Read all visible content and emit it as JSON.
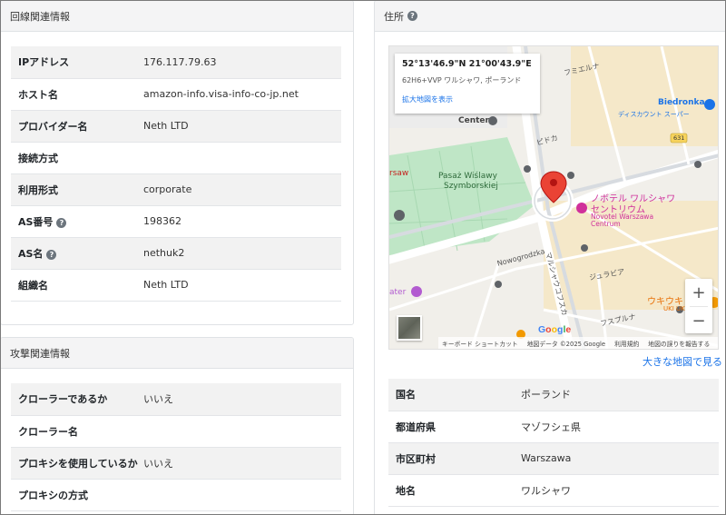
{
  "line_info": {
    "title": "回線関連情報",
    "rows": [
      {
        "key": "IPアドレス",
        "value": "176.117.79.63"
      },
      {
        "key": "ホスト名",
        "value": "amazon-info.visa-info-co-jp.net"
      },
      {
        "key": "プロバイダー名",
        "value": "Neth LTD"
      },
      {
        "key": "接続方式",
        "value": ""
      },
      {
        "key": "利用形式",
        "value": "corporate"
      },
      {
        "key": "AS番号",
        "value": "198362"
      },
      {
        "key": "AS名",
        "value": "nethuk2"
      },
      {
        "key": "組織名",
        "value": "Neth LTD"
      }
    ]
  },
  "attack_info": {
    "title": "攻撃関連情報",
    "rows": [
      {
        "key": "クローラーであるか",
        "value": "いいえ"
      },
      {
        "key": "クローラー名",
        "value": ""
      },
      {
        "key": "プロキシを使用しているか",
        "value": "いいえ"
      },
      {
        "key": "プロキシの方式",
        "value": ""
      }
    ]
  },
  "address": {
    "title": "住所",
    "larger_map_link": "大きな地図で見る",
    "rows": [
      {
        "key": "国名",
        "value": "ポーランド"
      },
      {
        "key": "都道府県",
        "value": "マゾフシェ県"
      },
      {
        "key": "市区町村",
        "value": "Warszawa"
      },
      {
        "key": "地名",
        "value": "ワルシャワ"
      }
    ]
  },
  "map": {
    "info_coords": "52°13'46.9\"N 21°00'43.9\"E",
    "info_plus_code": "62H6+VVP ワルシャワ, ポーランド",
    "info_link": "拡大地図を表示",
    "zoom_in": "+",
    "zoom_out": "−",
    "google_logo": "Google",
    "attribution": {
      "shortcuts": "キーボード ショートカット",
      "data": "地図データ ©2025 Google",
      "terms": "利用規約",
      "report": "地図の誤りを報告する"
    },
    "labels": {
      "fumierna": "フミエルナ",
      "biedronka": "Biedronka",
      "biedronka_sub": "ディスカウント スーパー",
      "center": "Center",
      "pidoka": "ピドカ",
      "road_631": "631",
      "warsaw": "rsaw",
      "plac1": "Pasaż Wiślawy",
      "plac2": "Szymborskiej",
      "novotel_jp1": "ノボテル ワルシャワ",
      "novotel_jp2": "セントリウム",
      "novotel_en1": "Novotel Warszawa",
      "novotel_en2": "Centrum",
      "nowogrodzka": "Nowogrodzka",
      "marszalkowska": "マルシャウコフスカ",
      "jurabia": "ジュラビア",
      "water": "ater",
      "fusupurna": "フスプルナ",
      "ukiuki": "ウキウキ",
      "ukiuk": "UKI UK"
    }
  },
  "colors": {
    "accent_link": "#1a73e8",
    "pin": "#ea4335",
    "novotel": "#d0309b",
    "park": "#bfe6c6"
  }
}
